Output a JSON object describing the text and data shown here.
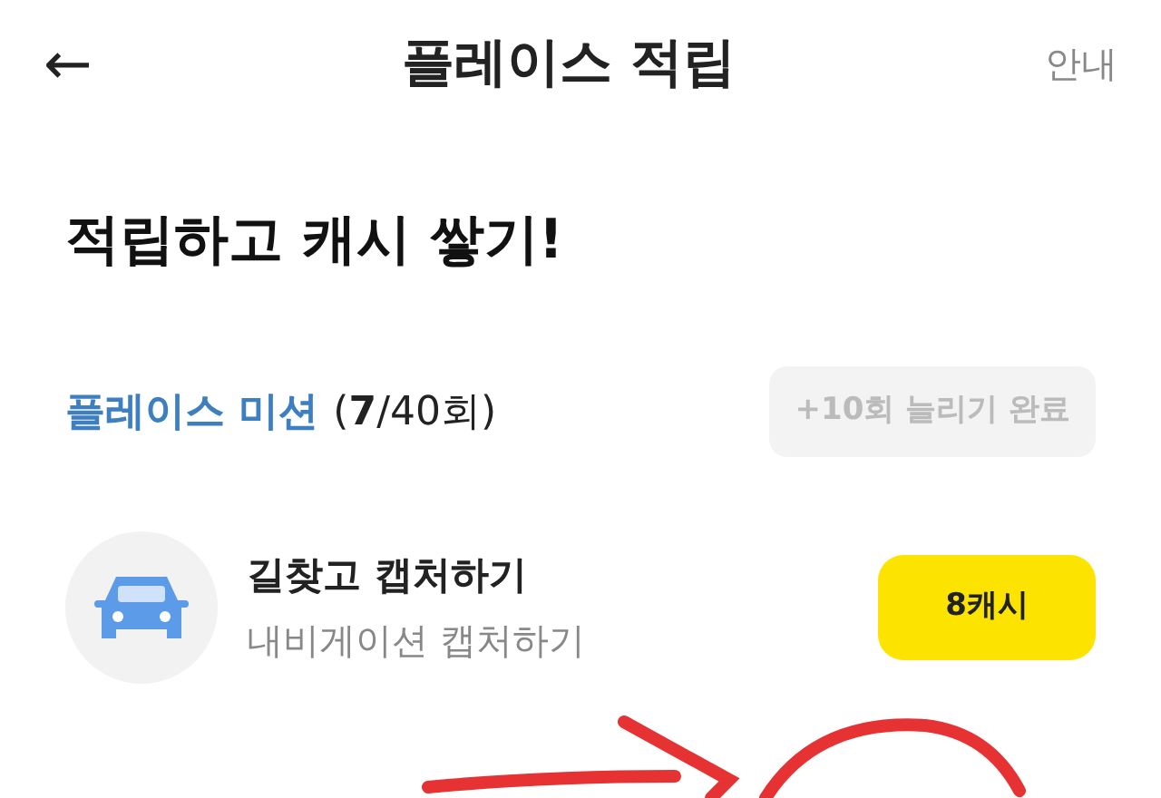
{
  "header": {
    "back": "←",
    "title": "플레이스 적립",
    "help": "안내"
  },
  "headline": "적립하고 캐시 쌓기!",
  "mission": {
    "title": "플레이스 미션",
    "count": "(**7**/40회)",
    "extend_button": {
      "label": "+10회 늘리기 완료",
      "disabled": true
    }
  },
  "tasks": [
    {
      "title": "길찾고 캡처하기",
      "subtitle": "내비게이션 캡처하기",
      "reward": "8캐시"
    }
  ]
}
